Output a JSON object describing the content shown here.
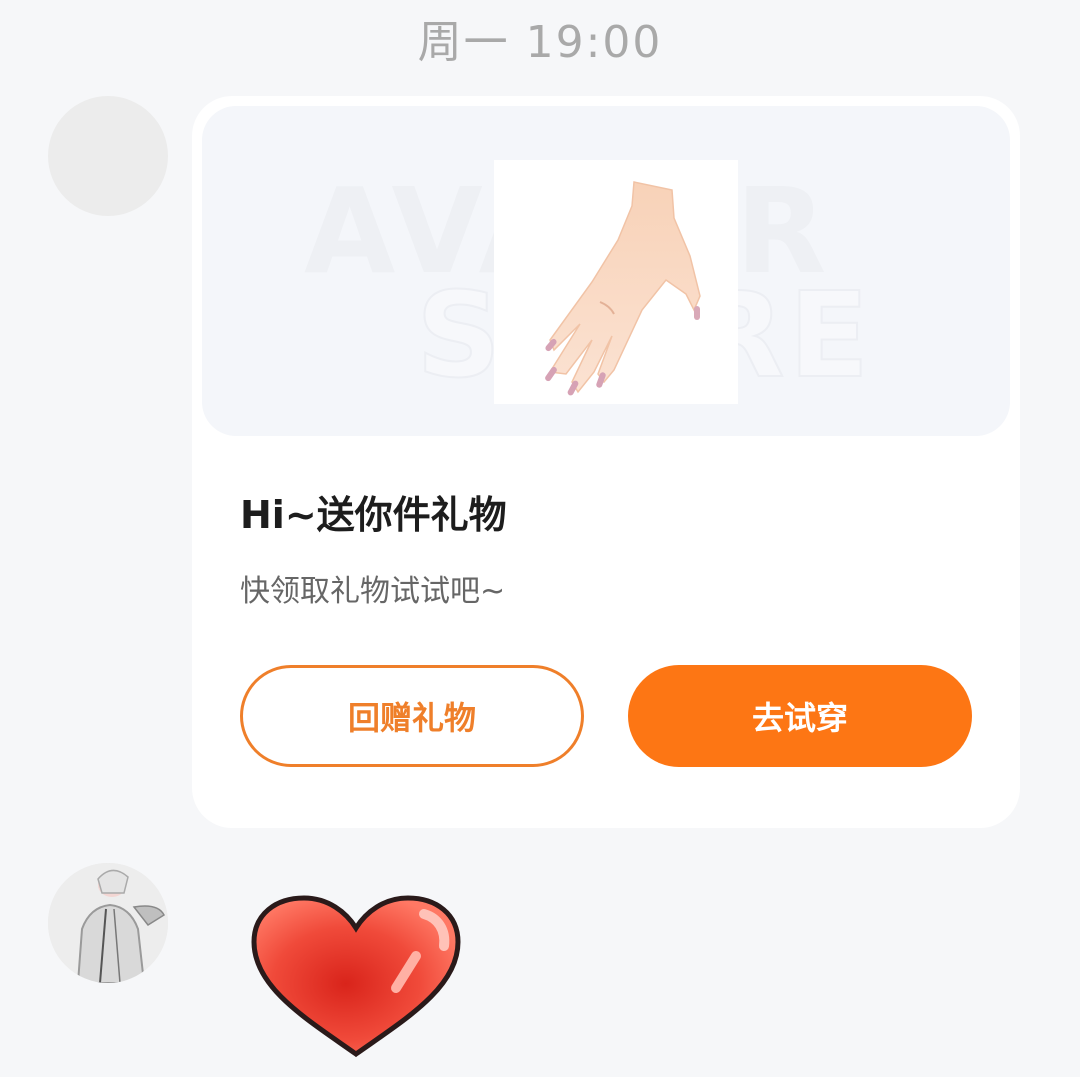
{
  "timestamp": "周一 19:00",
  "gift_card": {
    "banner_watermark_line1": "AVATAR",
    "banner_watermark_line2": "STORE",
    "title": "Hi~送你件礼物",
    "subtitle": "快领取礼物试试吧~",
    "return_gift_label": "回赠礼物",
    "try_on_label": "去试穿"
  },
  "colors": {
    "accent": "#fd7614",
    "outline_accent": "#ef7f2a",
    "background": "#f6f7f9",
    "heart": "#e8332a"
  },
  "icons": {
    "gift_image": "hand-with-nails-icon",
    "sticker": "heart-icon"
  }
}
